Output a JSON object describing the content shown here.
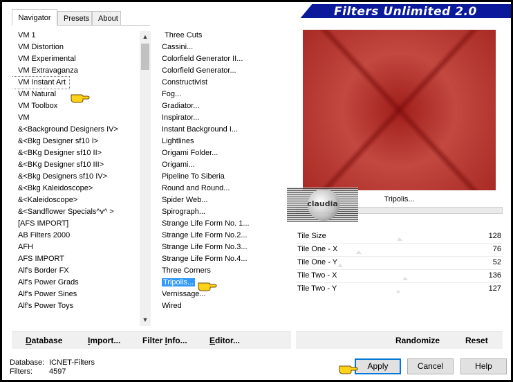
{
  "window": {
    "title": "Filters Unlimited 2.0"
  },
  "tabs": [
    {
      "label": "Navigator",
      "active": true
    },
    {
      "label": "Presets",
      "active": false
    },
    {
      "label": "About",
      "active": false
    }
  ],
  "categories": [
    "VM 1",
    "VM Distortion",
    "VM Experimental",
    "VM Extravaganza",
    "VM Instant Art",
    "VM Natural",
    "VM Toolbox",
    "VM",
    "&<Background Designers IV>",
    "&<Bkg Designer sf10 I>",
    "&<BKg Designer sf10 II>",
    "&<BKg Designer sf10 III>",
    "&<Bkg Designers sf10 IV>",
    "&<Bkg Kaleidoscope>",
    "&<Kaleidoscope>",
    "&<Sandflower Specials^v^ >",
    "[AFS IMPORT]",
    "AB Filters 2000",
    "AFH",
    "AFS IMPORT",
    "Alf's Border FX",
    "Alf's Power Grads",
    "Alf's Power Sines",
    "Alf's Power Toys"
  ],
  "selected_category": "VM Instant Art",
  "filters": [
    "Three Cuts",
    "Cassini...",
    "Colorfield Generator II...",
    "Colorfield Generator...",
    "Constructivist",
    "Fog...",
    "Gradiator...",
    "Inspirator...",
    "Instant Background I...",
    "Lightlines",
    "Origami Folder...",
    "Origami...",
    "Pipeline To Siberia",
    "Round and Round...",
    "Spider Web...",
    "Spirograph...",
    "Strange Life Form No. 1...",
    "Strange Life Form No.2...",
    "Strange Life Form No.3...",
    "Strange Life Form No.4...",
    "Three Corners",
    "Tripolis...",
    "Vernissage...",
    "Wired"
  ],
  "selected_filter": "Tripolis...",
  "preview": {
    "filter_name": "Tripolis...",
    "colors": {
      "base": "#b2302a",
      "dark": "#8e1a16"
    }
  },
  "watermark": {
    "text": "claudia"
  },
  "params": [
    {
      "label": "Tile Size",
      "value": "128"
    },
    {
      "label": "Tile One - X",
      "value": "76"
    },
    {
      "label": "Tile One - Y",
      "value": "52"
    },
    {
      "label": "Tile Two - X",
      "value": "136"
    },
    {
      "label": "Tile Two - Y",
      "value": "127"
    }
  ],
  "bottom_left_buttons": {
    "database_pre": "",
    "database_u": "D",
    "database_post": "atabase",
    "import_pre": "",
    "import_u": "I",
    "import_post": "mport...",
    "filterinfo_pre": "Filter ",
    "filterinfo_u": "I",
    "filterinfo_post": "nfo...",
    "editor_pre": "",
    "editor_u": "E",
    "editor_post": "ditor..."
  },
  "bottom_right_buttons": {
    "randomize": "Randomize",
    "reset": "Reset"
  },
  "status": {
    "database_key": "Database:",
    "database_value": "ICNET-Filters",
    "filters_key": "Filters:",
    "filters_value": "4597"
  },
  "dialog_buttons": {
    "apply": "Apply",
    "cancel": "Cancel",
    "help": "Help"
  },
  "colors": {
    "accent": "#0078d7",
    "selection": "#3399ff",
    "banner": "#0a1a9a"
  },
  "icons": {
    "pointer": "pointing-hand-icon"
  }
}
